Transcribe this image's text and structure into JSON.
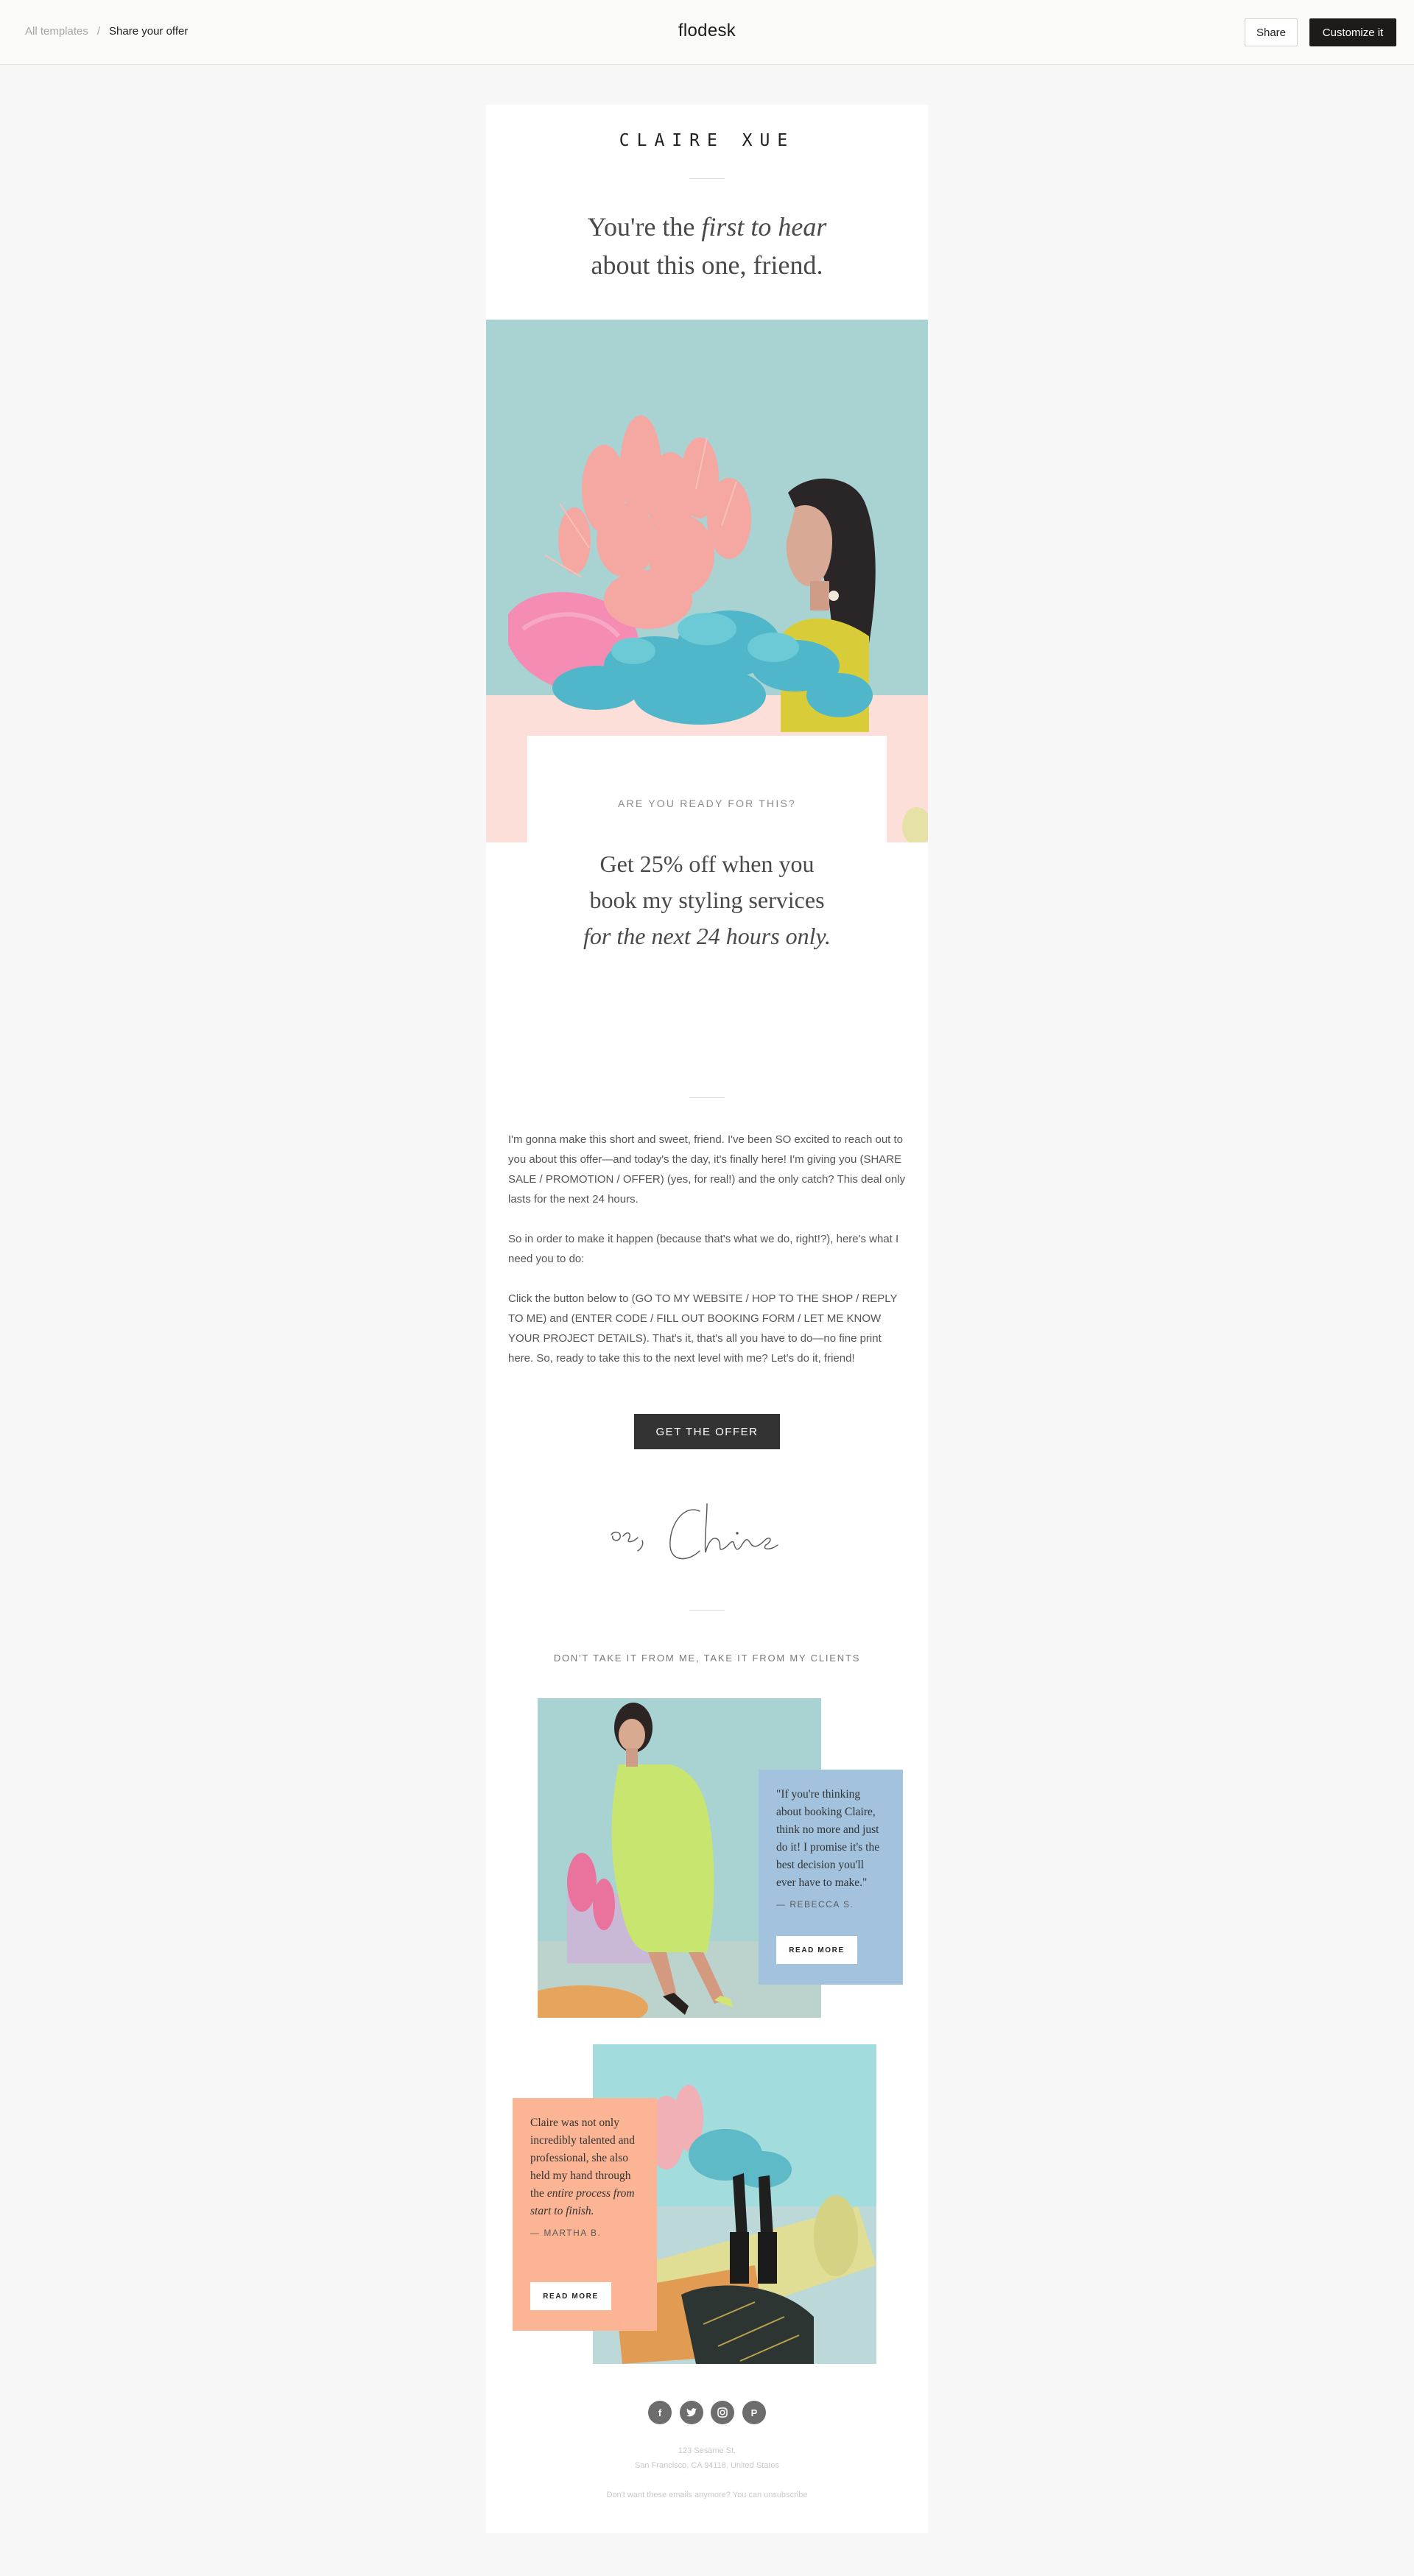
{
  "topbar": {
    "breadcrumb_root": "All templates",
    "breadcrumb_sep": "/",
    "breadcrumb_current": "Share your offer",
    "brand": "flodesk",
    "share_label": "Share",
    "customize_label": "Customize it"
  },
  "email": {
    "sender_name": "CLAIRE XUE",
    "headline_pre": "You're the ",
    "headline_em": "first to hear",
    "headline_post": "about this one, friend.",
    "offer": {
      "eyebrow": "ARE YOU READY FOR THIS?",
      "line1": "Get 25% off when you",
      "line2": "book my styling services",
      "line3": "for the next 24 hours only."
    },
    "paragraphs": [
      "I'm gonna make this short and sweet, friend. I've been SO excited to reach out to you about this offer—and today's the day, it's finally here! I'm giving you (SHARE SALE / PROMOTION / OFFER) (yes, for real!) and the only catch? This deal only lasts for the next 24 hours.",
      "So in order to make it happen (because that's what we do, right!?), here's what I need you to do:",
      "Click the button below to (GO TO MY WEBSITE / HOP TO THE SHOP / REPLY TO ME) and (ENTER CODE / FILL OUT BOOKING FORM / LET ME KNOW YOUR PROJECT DETAILS). That's it, that's all you have to do—no fine print here. So, ready to take this to the next level with me? Let's do it, friend!"
    ],
    "cta_label": "GET THE OFFER",
    "clients_title": "DON'T TAKE IT FROM ME, TAKE IT FROM MY CLIENTS",
    "testimonials": [
      {
        "quote": "\"If you're thinking about booking Claire, think no more and just do it! I promise it's the best decision you'll ever have to make.\"",
        "author": "— REBECCA S.",
        "button": "READ MORE",
        "box_color": "#a2c2dd"
      },
      {
        "quote_pre": "Claire was not only incredibly talented and professional, she also held my hand through the ",
        "quote_em": "entire process from start to finish.",
        "author": "— MARTHA B.",
        "button": "READ MORE",
        "box_color": "#fbb595"
      }
    ],
    "socials": [
      "facebook-icon",
      "twitter-icon",
      "instagram-icon",
      "pinterest-icon"
    ],
    "footer_address_line1": "123 Sesame St.",
    "footer_address_line2": "San Francisco, CA 94118, United States",
    "footer_unsubscribe": "Don't want these emails anymore? You can unsubscribe",
    "colors": {
      "hero_teal": "#a9d3d3",
      "hero_pink": "#fcdfd8",
      "cta": "#333333"
    }
  }
}
